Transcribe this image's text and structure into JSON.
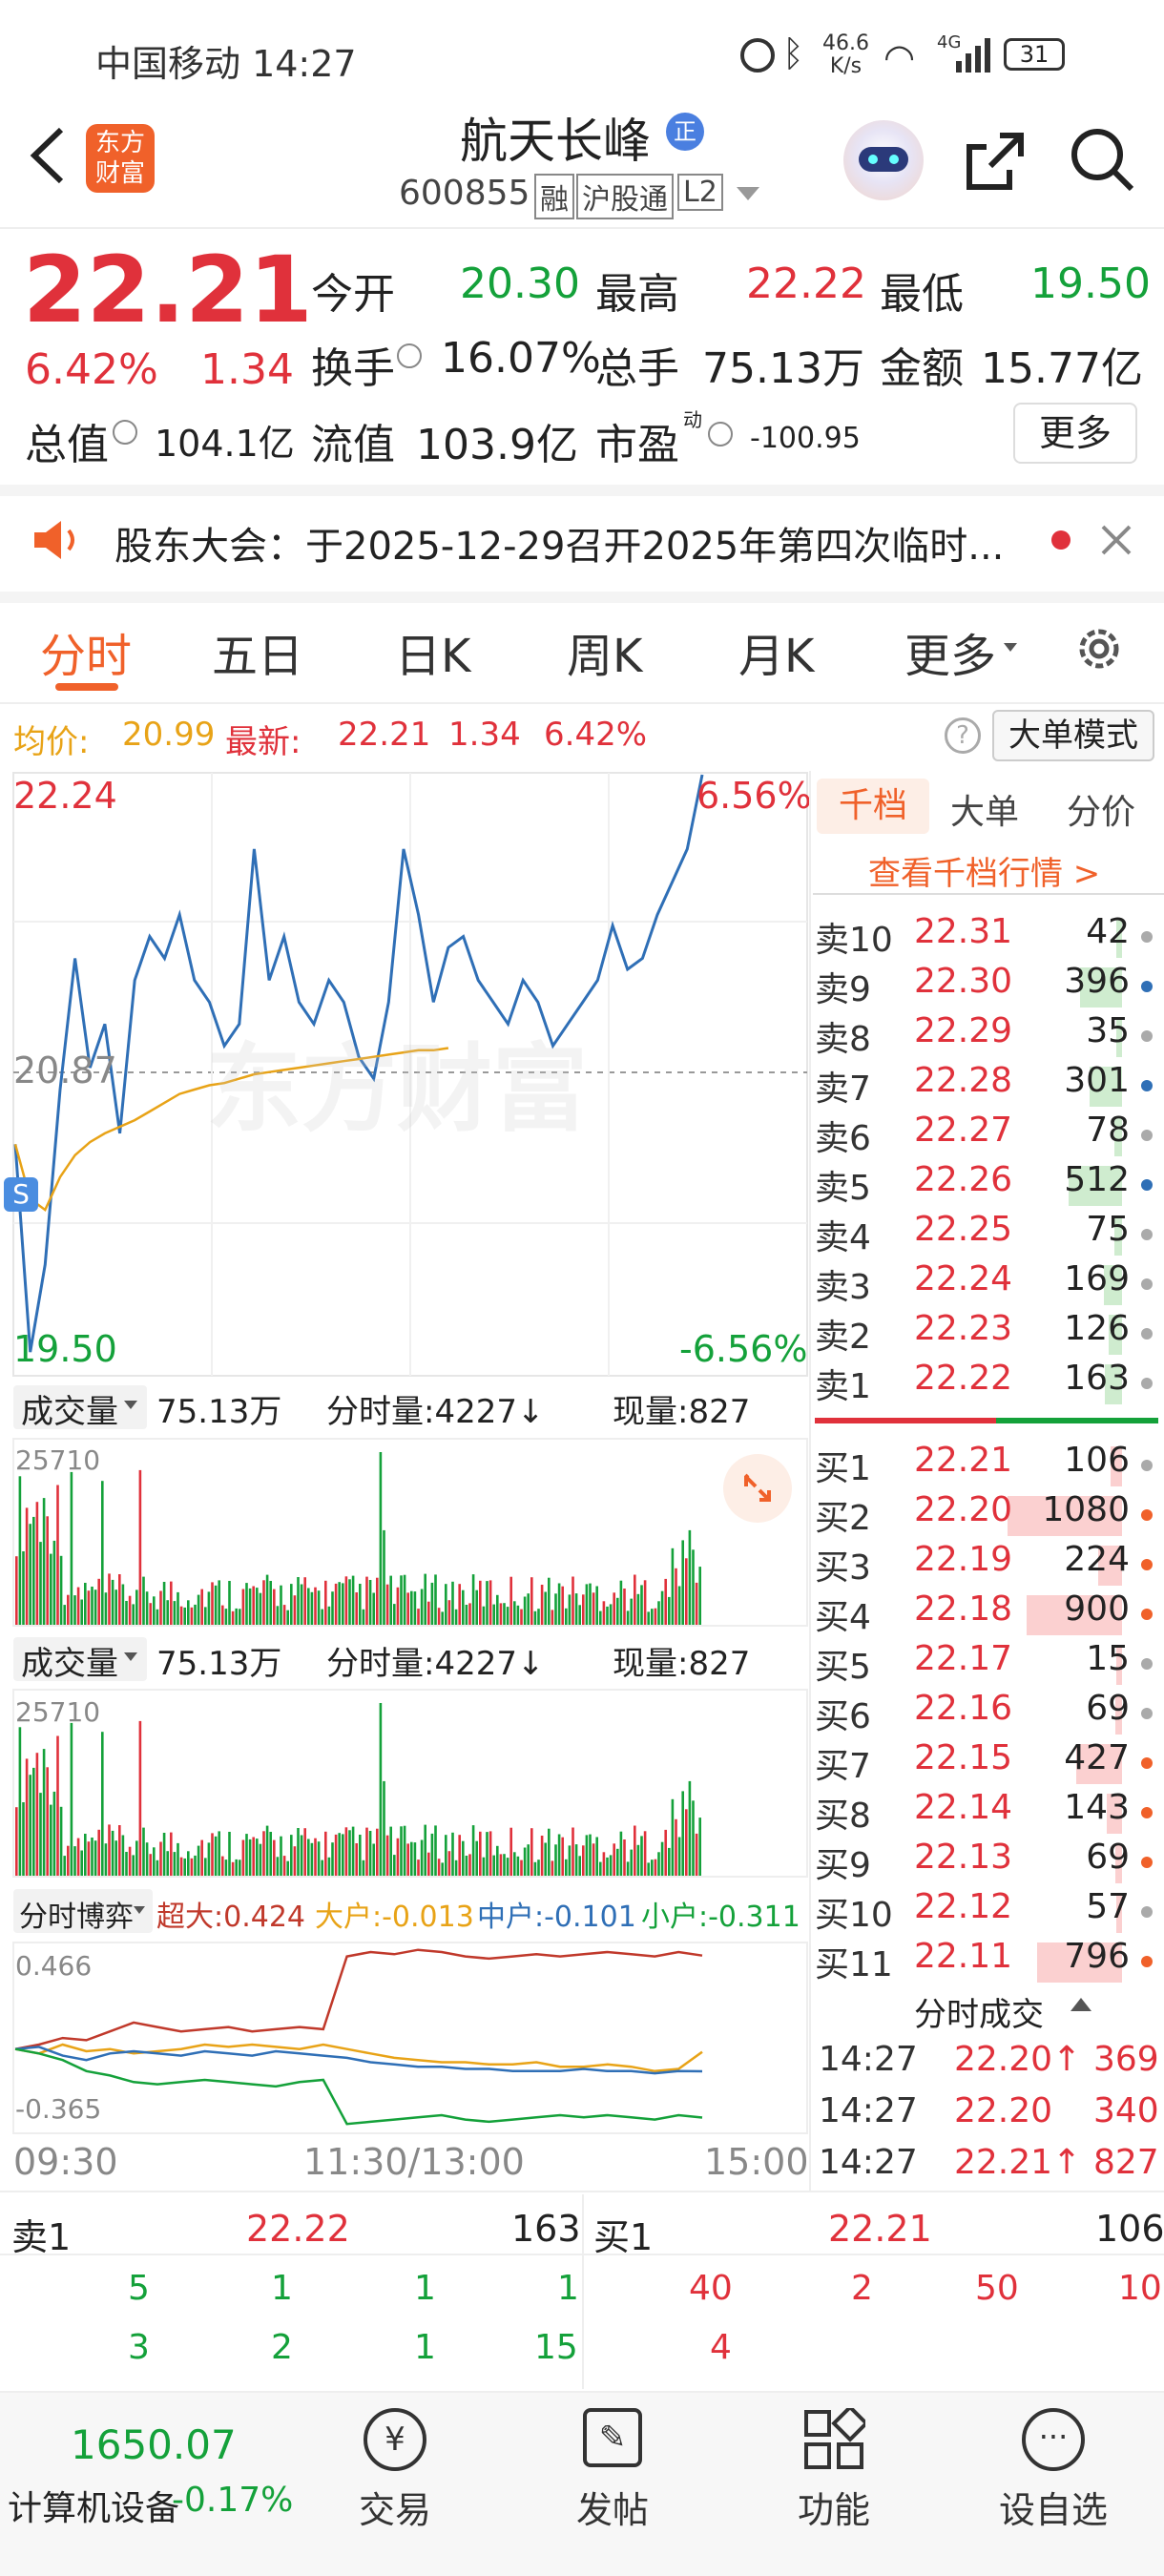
{
  "status_bar": {
    "carrier_time": "中国移动 14:27",
    "net_speed_top": "46.6",
    "net_speed_bottom": "K/s",
    "net_type": "4G",
    "battery": "31"
  },
  "header": {
    "logo_line1": "东方",
    "logo_line2": "财富",
    "stock_name": "航天长峰",
    "badge": "正",
    "code": "600855",
    "tags": [
      "融",
      "沪股通",
      "L2"
    ]
  },
  "quote": {
    "price": "22.21",
    "change_pct": "6.42%",
    "change_amt": "1.34",
    "open_label": "今开",
    "open": "20.30",
    "high_label": "最高",
    "high": "22.22",
    "low_label": "最低",
    "low": "19.50",
    "turnover_label": "换手",
    "turnover": "16.07%",
    "volume_label": "总手",
    "volume": "75.13万",
    "amount_label": "金额",
    "amount": "15.77亿",
    "mcap_label": "总值",
    "mcap": "104.1亿",
    "float_label": "流值",
    "float": "103.9亿",
    "pe_label": "市盈",
    "pe_sup": "动",
    "pe": "-100.95",
    "more": "更多"
  },
  "notice": {
    "text": "股东大会：于2025-12-29召开2025年第四次临时..."
  },
  "tabs": [
    "分时",
    "五日",
    "日K",
    "周K",
    "月K",
    "更多"
  ],
  "info_line": {
    "avg_label": "均价:",
    "avg": "20.99",
    "latest_label": "最新:",
    "latest": "22.21",
    "chg": "1.34",
    "pct": "6.42%",
    "mode": "大单模式"
  },
  "chart_data": [
    {
      "type": "line",
      "series": [
        {
          "values": [
            20.55,
            19.6,
            20.0,
            20.8,
            21.4,
            20.9,
            21.1,
            20.6,
            21.3,
            21.5,
            21.4,
            21.6,
            21.3,
            21.2,
            21.0,
            21.1,
            21.9,
            21.3,
            21.5,
            21.2,
            21.1,
            21.3,
            21.2,
            20.95,
            20.85,
            21.2,
            21.9,
            21.6,
            21.2,
            21.45,
            21.5,
            21.3,
            21.2,
            21.1,
            21.3,
            21.2,
            21.0,
            21.1,
            21.2,
            21.3,
            21.55,
            21.35,
            21.4,
            21.6,
            21.75,
            21.9,
            22.24
          ]
        },
        {
          "values": [
            20.55,
            20.3,
            20.25,
            20.4,
            20.5,
            20.56,
            20.6,
            20.63,
            20.66,
            20.7,
            20.74,
            20.78,
            20.8,
            20.82,
            20.83,
            20.85,
            20.87,
            20.88,
            20.89,
            20.9,
            20.91,
            20.92,
            20.93,
            20.94,
            20.95,
            20.96,
            20.97,
            20.98,
            20.98,
            20.99
          ]
        }
      ],
      "ylim": [
        19.5,
        22.24
      ],
      "ticks_left": [
        "22.24",
        "20.87",
        "19.50"
      ],
      "ticks_right": [
        "6.56%",
        "-6.56%"
      ],
      "watermark": "东方财富"
    },
    {
      "type": "bar",
      "title": "成交量",
      "total": "75.13万",
      "minute_vol": "分时量:4227↓",
      "current_vol": "现量:827",
      "ymax": "25710"
    },
    {
      "type": "bar",
      "title": "成交量",
      "total": "75.13万",
      "minute_vol": "分时量:4227↓",
      "current_vol": "现量:827",
      "ymax": "25710"
    },
    {
      "type": "line",
      "title": "分时博弈",
      "series": [
        {
          "name": "超大:0.424",
          "values": [
            0.0,
            0.02,
            0.05,
            0.04,
            0.08,
            0.12,
            0.1,
            0.08,
            0.09,
            0.1,
            0.08,
            0.09,
            0.1,
            0.09,
            0.42,
            0.44,
            0.43,
            0.45,
            0.44,
            0.42,
            0.41,
            0.42,
            0.43,
            0.42,
            0.43,
            0.44,
            0.43,
            0.42,
            0.44,
            0.424
          ]
        },
        {
          "name": "大户:-0.013",
          "values": [
            0.0,
            -0.02,
            0.02,
            -0.01,
            0.0,
            -0.02,
            -0.01,
            0.0,
            0.02,
            0.01,
            0.02,
            0.01,
            0.0,
            0.02,
            0.0,
            -0.02,
            -0.04,
            -0.05,
            -0.06,
            -0.06,
            -0.07,
            -0.07,
            -0.06,
            -0.08,
            -0.08,
            -0.07,
            -0.08,
            -0.1,
            -0.09,
            -0.013
          ]
        },
        {
          "name": "中户:-0.101",
          "values": [
            0.0,
            0.01,
            -0.03,
            -0.05,
            -0.02,
            -0.01,
            -0.02,
            -0.03,
            -0.01,
            -0.02,
            -0.03,
            -0.01,
            -0.02,
            -0.03,
            -0.04,
            -0.06,
            -0.07,
            -0.08,
            -0.08,
            -0.09,
            -0.09,
            -0.1,
            -0.1,
            -0.1,
            -0.09,
            -0.1,
            -0.1,
            -0.11,
            -0.1,
            -0.101
          ]
        },
        {
          "name": "小户:-0.311",
          "values": [
            0.0,
            -0.02,
            -0.05,
            -0.1,
            -0.12,
            -0.15,
            -0.16,
            -0.15,
            -0.14,
            -0.15,
            -0.16,
            -0.17,
            -0.15,
            -0.14,
            -0.34,
            -0.33,
            -0.32,
            -0.31,
            -0.3,
            -0.32,
            -0.33,
            -0.32,
            -0.31,
            -0.3,
            -0.31,
            -0.3,
            -0.31,
            -0.32,
            -0.3,
            -0.311
          ]
        }
      ],
      "ymax": "0.466",
      "ymin": "-0.365"
    }
  ],
  "time_axis": [
    "09:30",
    "11:30/13:00",
    "15:00"
  ],
  "orderbook": {
    "tabs": [
      "千档",
      "大单",
      "分价"
    ],
    "link": "查看千档行情 >",
    "asks": [
      [
        "卖10",
        "22.31",
        "42"
      ],
      [
        "卖9",
        "22.30",
        "396"
      ],
      [
        "卖8",
        "22.29",
        "35"
      ],
      [
        "卖7",
        "22.28",
        "301"
      ],
      [
        "卖6",
        "22.27",
        "78"
      ],
      [
        "卖5",
        "22.26",
        "512"
      ],
      [
        "卖4",
        "22.25",
        "75"
      ],
      [
        "卖3",
        "22.24",
        "169"
      ],
      [
        "卖2",
        "22.23",
        "126"
      ],
      [
        "卖1",
        "22.22",
        "163"
      ]
    ],
    "bids": [
      [
        "买1",
        "22.21",
        "106"
      ],
      [
        "买2",
        "22.20",
        "1080"
      ],
      [
        "买3",
        "22.19",
        "224"
      ],
      [
        "买4",
        "22.18",
        "900"
      ],
      [
        "买5",
        "22.17",
        "15"
      ],
      [
        "买6",
        "22.16",
        "69"
      ],
      [
        "买7",
        "22.15",
        "427"
      ],
      [
        "买8",
        "22.14",
        "143"
      ],
      [
        "买9",
        "22.13",
        "69"
      ],
      [
        "买10",
        "22.12",
        "57"
      ],
      [
        "买11",
        "22.11",
        "796"
      ]
    ],
    "ask_levels": [
      0.04,
      0.37,
      0.03,
      0.28,
      0.07,
      0.47,
      0.07,
      0.16,
      0.12,
      0.15
    ],
    "bid_levels": [
      0.1,
      1.0,
      0.21,
      0.83,
      0.01,
      0.06,
      0.4,
      0.13,
      0.06,
      0.05,
      0.74
    ],
    "trades_title": "分时成交",
    "trades": [
      [
        "14:27",
        "22.20↑",
        "369"
      ],
      [
        "14:27",
        "22.20",
        "340"
      ],
      [
        "14:27",
        "22.21↑",
        "827"
      ]
    ]
  },
  "bottom_book": {
    "ask_label": "卖1",
    "ask_price": "22.22",
    "ask_vol": "163",
    "bid_label": "买1",
    "bid_price": "22.21",
    "bid_vol": "106",
    "ask_row1": [
      "5",
      "1",
      "1",
      "1"
    ],
    "ask_row2": [
      "3",
      "2",
      "1",
      "15"
    ],
    "bid_row1": [
      "40",
      "2",
      "50",
      "10"
    ],
    "bid_row2": [
      "4"
    ]
  },
  "bottom_nav": {
    "index_value": "1650.07",
    "index_name": "计算机设备",
    "index_change": "-0.17%",
    "items": [
      "交易",
      "发帖",
      "功能",
      "设自选"
    ]
  },
  "colors": {
    "up": "#e0313b",
    "down": "#14a13a",
    "accent": "#f0612a",
    "price_line": "#2f6fb6",
    "avg_line": "#e8a317"
  }
}
